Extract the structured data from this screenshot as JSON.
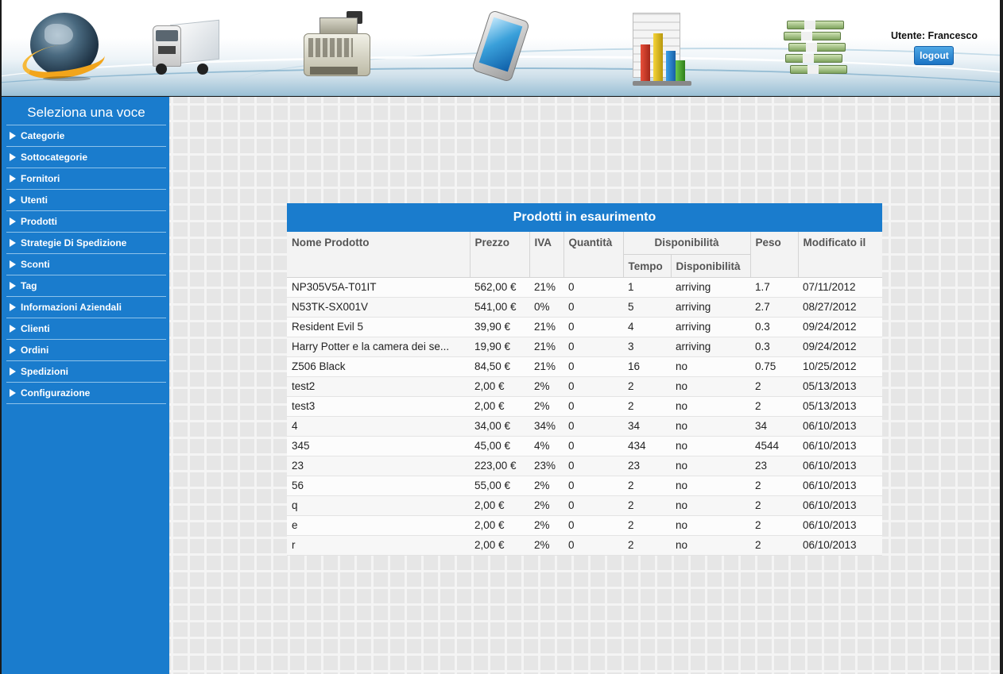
{
  "header": {
    "icons": [
      "globe-icon",
      "truck-icon",
      "cash-register-icon",
      "tablet-icon",
      "bar-chart-icon",
      "money-icon"
    ],
    "user_label": "Utente: Francesco",
    "logout_label": "logout"
  },
  "sidebar": {
    "title": "Seleziona una voce",
    "items": [
      {
        "label": "Categorie"
      },
      {
        "label": "Sottocategorie"
      },
      {
        "label": "Fornitori"
      },
      {
        "label": "Utenti"
      },
      {
        "label": "Prodotti"
      },
      {
        "label": "Strategie Di Spedizione"
      },
      {
        "label": "Sconti"
      },
      {
        "label": "Tag"
      },
      {
        "label": "Informazioni Aziendali"
      },
      {
        "label": "Clienti"
      },
      {
        "label": "Ordini"
      },
      {
        "label": "Spedizioni"
      },
      {
        "label": "Configurazione"
      }
    ]
  },
  "table": {
    "title": "Prodotti in esaurimento",
    "headers": {
      "nome": "Nome Prodotto",
      "prezzo": "Prezzo",
      "iva": "IVA",
      "quantita": "Quantità",
      "disponibilita_group": "Disponibilità",
      "tempo": "Tempo",
      "disponibilita": "Disponibilità",
      "peso": "Peso",
      "modificato": "Modificato il"
    },
    "rows": [
      {
        "nome": "NP305V5A-T01IT",
        "prezzo": "562,00 €",
        "iva": "21%",
        "quantita": "0",
        "tempo": "1",
        "disp": "arriving",
        "peso": "1.7",
        "mod": "07/11/2012"
      },
      {
        "nome": "N53TK-SX001V",
        "prezzo": "541,00 €",
        "iva": "0%",
        "quantita": "0",
        "tempo": "5",
        "disp": "arriving",
        "peso": "2.7",
        "mod": "08/27/2012"
      },
      {
        "nome": "Resident Evil 5",
        "prezzo": "39,90 €",
        "iva": "21%",
        "quantita": "0",
        "tempo": "4",
        "disp": "arriving",
        "peso": "0.3",
        "mod": "09/24/2012"
      },
      {
        "nome": "Harry Potter e la camera dei se...",
        "prezzo": "19,90 €",
        "iva": "21%",
        "quantita": "0",
        "tempo": "3",
        "disp": "arriving",
        "peso": "0.3",
        "mod": "09/24/2012"
      },
      {
        "nome": "Z506 Black",
        "prezzo": "84,50 €",
        "iva": "21%",
        "quantita": "0",
        "tempo": "16",
        "disp": "no",
        "peso": "0.75",
        "mod": "10/25/2012"
      },
      {
        "nome": "test2",
        "prezzo": "2,00 €",
        "iva": "2%",
        "quantita": "0",
        "tempo": "2",
        "disp": "no",
        "peso": "2",
        "mod": "05/13/2013"
      },
      {
        "nome": "test3",
        "prezzo": "2,00 €",
        "iva": "2%",
        "quantita": "0",
        "tempo": "2",
        "disp": "no",
        "peso": "2",
        "mod": "05/13/2013"
      },
      {
        "nome": "4",
        "prezzo": "34,00 €",
        "iva": "34%",
        "quantita": "0",
        "tempo": "34",
        "disp": "no",
        "peso": "34",
        "mod": "06/10/2013"
      },
      {
        "nome": "345",
        "prezzo": "45,00 €",
        "iva": "4%",
        "quantita": "0",
        "tempo": "434",
        "disp": "no",
        "peso": "4544",
        "mod": "06/10/2013"
      },
      {
        "nome": "23",
        "prezzo": "223,00 €",
        "iva": "23%",
        "quantita": "0",
        "tempo": "23",
        "disp": "no",
        "peso": "23",
        "mod": "06/10/2013"
      },
      {
        "nome": "56",
        "prezzo": "55,00 €",
        "iva": "2%",
        "quantita": "0",
        "tempo": "2",
        "disp": "no",
        "peso": "2",
        "mod": "06/10/2013"
      },
      {
        "nome": "q",
        "prezzo": "2,00 €",
        "iva": "2%",
        "quantita": "0",
        "tempo": "2",
        "disp": "no",
        "peso": "2",
        "mod": "06/10/2013"
      },
      {
        "nome": "e",
        "prezzo": "2,00 €",
        "iva": "2%",
        "quantita": "0",
        "tempo": "2",
        "disp": "no",
        "peso": "2",
        "mod": "06/10/2013"
      },
      {
        "nome": "r",
        "prezzo": "2,00 €",
        "iva": "2%",
        "quantita": "0",
        "tempo": "2",
        "disp": "no",
        "peso": "2",
        "mod": "06/10/2013"
      }
    ]
  },
  "colors": {
    "accent": "#1a7ccd",
    "header_bg": "#f3f3f3",
    "grid_bg": "#e6e6e6"
  }
}
